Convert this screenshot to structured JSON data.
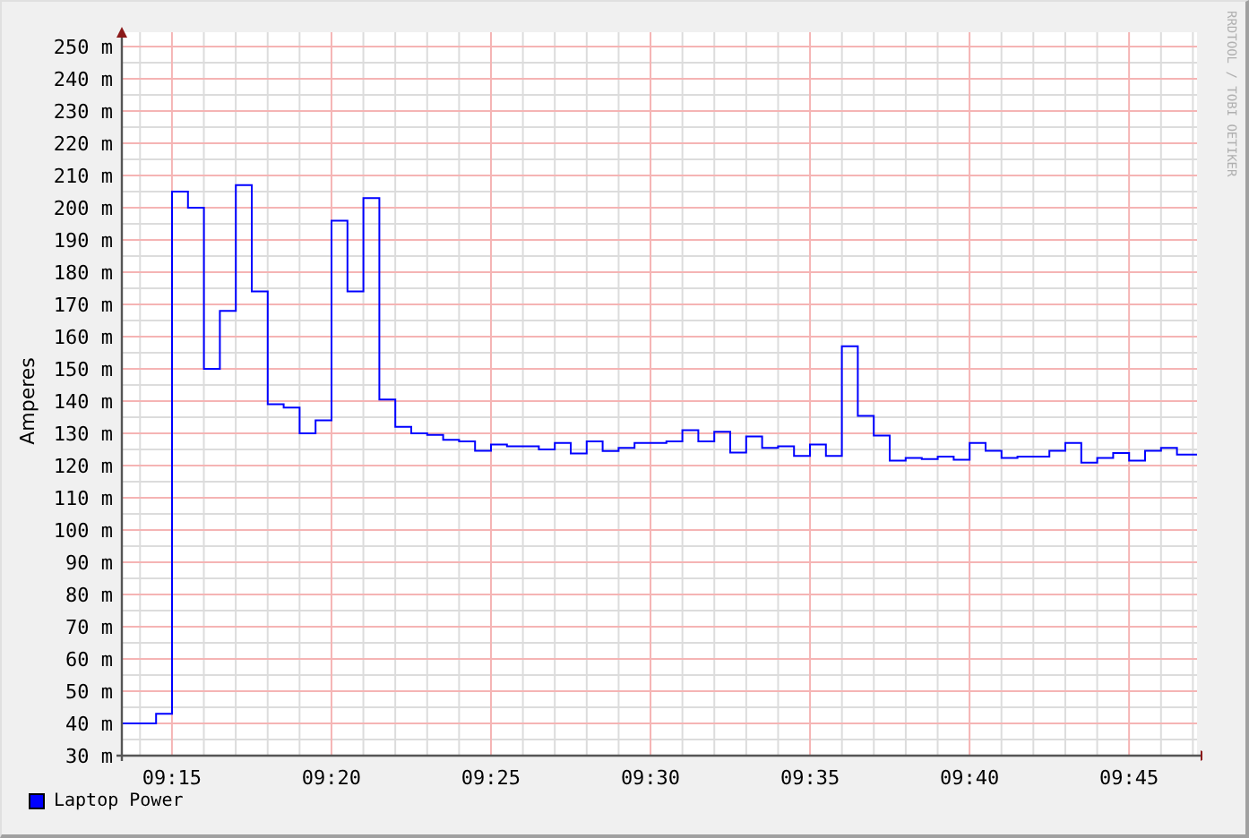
{
  "chart": {
    "chart_data": {
      "type": "line",
      "grid": true,
      "ylabel": "Amperes",
      "x": [
        553.43,
        554,
        554,
        554.5,
        554.5,
        555,
        555,
        555.5,
        555.5,
        556,
        556,
        556.5,
        556.5,
        557,
        557,
        557.5,
        557.5,
        558,
        558,
        558.5,
        558.5,
        559,
        559,
        559.5,
        559.5,
        560,
        560,
        560.5,
        560.5,
        561,
        561,
        561.5,
        561.5,
        562,
        562,
        562.5,
        562.5,
        563,
        563,
        563.5,
        563.5,
        564,
        564,
        564.5,
        564.5,
        565,
        565,
        565.5,
        565.5,
        566,
        566,
        566.5,
        566.5,
        567,
        567,
        567.5,
        567.5,
        568,
        568,
        568.5,
        568.5,
        569,
        569,
        569.5,
        569.5,
        570,
        570,
        570.5,
        570.5,
        571,
        571,
        571.5,
        571.5,
        572,
        572,
        572.5,
        572.5,
        573,
        573,
        573.5,
        573.5,
        574,
        574,
        574.5,
        574.5,
        575,
        575,
        575.5,
        575.5,
        576,
        576,
        576.5,
        576.5,
        577,
        577,
        577.5,
        577.5,
        578,
        578,
        578.5,
        578.5,
        579,
        579,
        579.5,
        579.5,
        580,
        580,
        580.5,
        580.5,
        581,
        581,
        581.5,
        581.5,
        582,
        582,
        582.5,
        582.5,
        583,
        583,
        583.5,
        583.5,
        584,
        584,
        584.5,
        584.5,
        585,
        585,
        585.5,
        585.5,
        586,
        586,
        586.5,
        586.5,
        587,
        587,
        587.13
      ],
      "series": [
        {
          "name": "Laptop Power",
          "color": "#0000ff",
          "values": [
            40,
            40,
            40,
            40,
            43,
            43,
            205,
            205,
            200,
            200,
            150,
            150,
            168,
            168,
            207,
            207,
            174,
            174,
            139,
            139,
            138,
            138,
            130,
            130,
            134,
            134,
            196,
            196,
            174,
            174,
            203,
            203,
            140.5,
            140.5,
            132,
            132,
            130,
            130,
            129.5,
            129.5,
            128,
            128,
            127.5,
            127.5,
            124.6,
            124.6,
            126.5,
            126.5,
            126,
            126,
            126,
            126,
            125,
            125,
            127,
            127,
            123.7,
            123.7,
            127.5,
            127.5,
            124.5,
            124.5,
            125.5,
            125.5,
            127,
            127,
            127,
            127,
            127.5,
            127.5,
            131,
            131,
            127.5,
            127.5,
            130.5,
            130.5,
            124,
            124,
            129,
            129,
            125.5,
            125.5,
            126,
            126,
            123,
            123,
            126.5,
            126.5,
            123,
            123,
            157,
            157,
            135.4,
            135.4,
            129.3,
            129.3,
            121.5,
            121.5,
            122.4,
            122.4,
            122,
            122,
            122.8,
            122.8,
            121.8,
            121.8,
            127,
            127,
            124.6,
            124.6,
            122.4,
            122.4,
            122.8,
            122.8,
            122.8,
            122.8,
            124.6,
            124.6,
            127,
            127,
            120.9,
            120.9,
            122.4,
            122.4,
            123.9,
            123.9,
            121.5,
            121.5,
            124.6,
            124.6,
            125.5,
            125.5,
            123.4,
            123.4,
            123.4,
            123.4
          ]
        }
      ],
      "xlim": [
        553.43,
        587.13
      ],
      "ylim": [
        30,
        250
      ],
      "xticks": [
        {
          "value": 555,
          "label": "09:15"
        },
        {
          "value": 560,
          "label": "09:20"
        },
        {
          "value": 565,
          "label": "09:25"
        },
        {
          "value": 570,
          "label": "09:30"
        },
        {
          "value": 575,
          "label": "09:35"
        },
        {
          "value": 580,
          "label": "09:40"
        },
        {
          "value": 585,
          "label": "09:45"
        }
      ],
      "yticks": [
        {
          "value": 30,
          "label": "30 m"
        },
        {
          "value": 40,
          "label": "40 m"
        },
        {
          "value": 50,
          "label": "50 m"
        },
        {
          "value": 60,
          "label": "60 m"
        },
        {
          "value": 70,
          "label": "70 m"
        },
        {
          "value": 80,
          "label": "80 m"
        },
        {
          "value": 90,
          "label": "90 m"
        },
        {
          "value": 100,
          "label": "100 m"
        },
        {
          "value": 110,
          "label": "110 m"
        },
        {
          "value": 120,
          "label": "120 m"
        },
        {
          "value": 130,
          "label": "130 m"
        },
        {
          "value": 140,
          "label": "140 m"
        },
        {
          "value": 150,
          "label": "150 m"
        },
        {
          "value": 160,
          "label": "160 m"
        },
        {
          "value": 170,
          "label": "170 m"
        },
        {
          "value": 180,
          "label": "180 m"
        },
        {
          "value": 190,
          "label": "190 m"
        },
        {
          "value": 200,
          "label": "200 m"
        },
        {
          "value": 210,
          "label": "210 m"
        },
        {
          "value": 220,
          "label": "220 m"
        },
        {
          "value": 230,
          "label": "230 m"
        },
        {
          "value": 240,
          "label": "240 m"
        },
        {
          "value": 250,
          "label": "250 m"
        }
      ]
    },
    "credit": "RRDTOOL / TOBI OETIKER"
  }
}
